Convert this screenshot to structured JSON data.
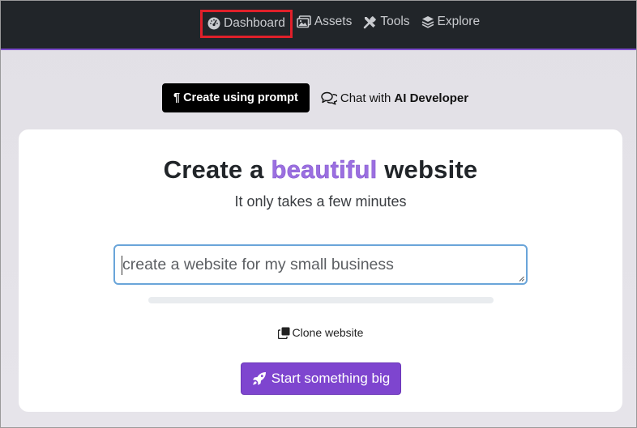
{
  "nav": {
    "items": [
      {
        "label": "Dashboard",
        "icon": "gauge-icon"
      },
      {
        "label": "Assets",
        "icon": "images-icon"
      },
      {
        "label": "Tools",
        "icon": "tools-icon"
      },
      {
        "label": "Explore",
        "icon": "layers-icon"
      }
    ],
    "highlighted": "Dashboard"
  },
  "mode": {
    "active_symbol": "¶",
    "active_label": "Create using prompt",
    "other_prefix": "Chat with",
    "other_bold": "AI Developer"
  },
  "card": {
    "headline_pre": "Create a",
    "headline_accent": "beautiful",
    "headline_post": "website",
    "subhead": "It only takes a few minutes",
    "prompt_placeholder": "create a website for my small business",
    "prompt_value": "",
    "clone_label": "Clone website",
    "go_label": "Start something big"
  },
  "colors": {
    "nav_bg": "#212529",
    "accent": "#7e45cf",
    "highlight_box": "#e0202a",
    "input_focus": "#6aa5d9"
  }
}
